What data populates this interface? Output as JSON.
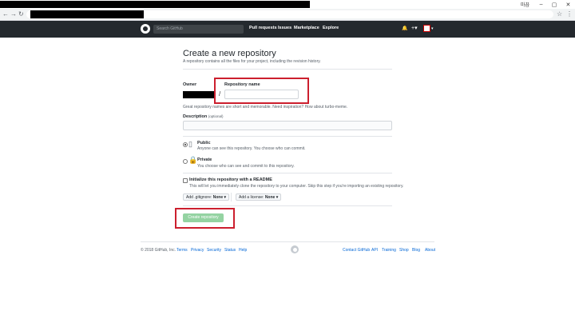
{
  "browser": {
    "user_label": "마끕",
    "min_icon": "–",
    "max_icon": "▢",
    "close_icon": "✕",
    "back_icon": "←",
    "forward_icon": "→",
    "reload_icon": "↻",
    "star_icon": "☆",
    "menu_icon": "⋮"
  },
  "header": {
    "search_placeholder": "Search GitHub",
    "nav": [
      "Pull requests",
      "Issues",
      "Marketplace",
      "Explore"
    ],
    "bell_icon": "🔔",
    "plus_label": "+▾",
    "avatar_caret": "▾"
  },
  "page": {
    "title": "Create a new repository",
    "subtitle": "A repository contains all the files for your project, including the revision history.",
    "owner_label": "Owner",
    "slash": "/",
    "repo_name_label": "Repository name",
    "repo_name_value": "",
    "name_hint": "Great repository names are short and memorable. Need inspiration? How about turbo-meme.",
    "description_label": "Description",
    "description_optional": "(optional)",
    "description_value": "",
    "visibility": {
      "public_title": "Public",
      "public_desc": "Anyone can see this repository. You choose who can commit.",
      "private_title": "Private",
      "private_desc": "You choose who can see and commit to this repository.",
      "selected": "public"
    },
    "readme_label": "Initialize this repository with a README",
    "readme_desc": "This will let you immediately clone the repository to your computer. Skip this step if you're importing an existing repository.",
    "gitignore_label": "Add .gitignore:",
    "gitignore_value": "None ▾",
    "license_label": "Add a license:",
    "license_value": "None ▾",
    "create_button": "Create repository"
  },
  "footer": {
    "copyright": "© 2018 GitHub, Inc.",
    "left_links": [
      "Terms",
      "Privacy",
      "Security",
      "Status",
      "Help"
    ],
    "right_links": [
      "Contact GitHub",
      "API",
      "Training",
      "Shop",
      "Blog",
      "About"
    ]
  },
  "colors": {
    "header_bg": "#24292e",
    "highlight_red": "#cc1f2e",
    "create_button_bg": "#94d3a2",
    "link_blue": "#0366d6"
  }
}
